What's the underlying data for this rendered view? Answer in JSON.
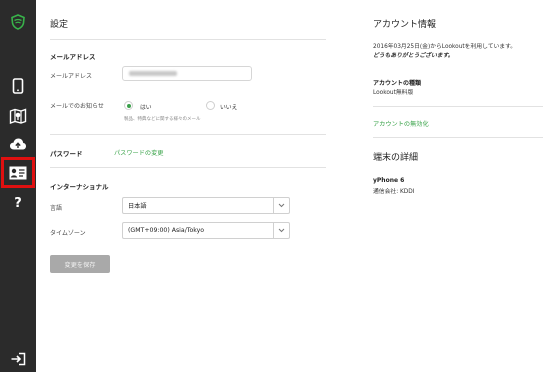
{
  "sidebar": {
    "icons": [
      "lookout-shield-icon",
      "phone-icon",
      "map-icon",
      "cloud-upload-icon",
      "account-card-icon",
      "help-icon",
      "logout-icon"
    ],
    "active": "account-card-icon",
    "highlight_color": "#e01010",
    "help_glyph": "?"
  },
  "settings": {
    "title": "設定",
    "email_section": "メールアドレス",
    "email_label": "メールアドレス",
    "notify_label": "メールでのお知らせ",
    "notify_yes": "はい",
    "notify_no": "いいえ",
    "notify_hint": "製品、特典などに関する様々のメール",
    "password_section": "パスワード",
    "password_link": "パスワードの変更",
    "intl_section": "インターナショナル",
    "language_label": "言語",
    "language_value": "日本語",
    "timezone_label": "タイムゾーン",
    "timezone_value": "(GMT+09:00) Asia/Tokyo",
    "save_button": "変更を保存"
  },
  "account": {
    "title": "アカウント情報",
    "since_text": "2016年03月25日(金)からLookoutを利用しています。",
    "thanks": "どうもありがとうございます。",
    "type_heading": "アカウントの種類",
    "type_value": "Lookout無料版",
    "deactivate_link": "アカウントの無効化"
  },
  "device": {
    "title": "端末の詳細",
    "name": "yPhone 6",
    "carrier": "通信会社: KDDI"
  },
  "colors": {
    "accent_green": "#39a349",
    "sidebar_bg": "#2b2b2b"
  }
}
